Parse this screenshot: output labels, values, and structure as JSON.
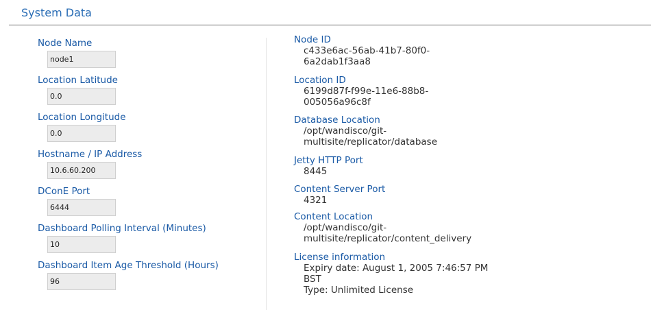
{
  "section": {
    "title": "System Data"
  },
  "left_fields": [
    {
      "label": "Node Name",
      "value": "node1"
    },
    {
      "label": "Location Latitude",
      "value": "0.0"
    },
    {
      "label": "Location Longitude",
      "value": "0.0"
    },
    {
      "label": "Hostname / IP Address",
      "value": "10.6.60.200"
    },
    {
      "label": "DConE Port",
      "value": "6444"
    },
    {
      "label": "Dashboard Polling Interval (Minutes)",
      "value": "10"
    },
    {
      "label": "Dashboard Item Age Threshold (Hours)",
      "value": "96"
    }
  ],
  "right_info": {
    "node_id": {
      "label": "Node ID",
      "lines": [
        "c433e6ac-56ab-41b7-80f0-",
        "6a2dab1f3aa8"
      ]
    },
    "location_id": {
      "label": "Location ID",
      "lines": [
        "6199d87f-f99e-11e6-88b8-",
        "005056a96c8f"
      ]
    },
    "database_location": {
      "label": "Database Location",
      "lines": [
        "/opt/wandisco/git-",
        "multisite/replicator/database"
      ]
    },
    "jetty_http_port": {
      "label": "Jetty HTTP Port",
      "lines": [
        "8445"
      ]
    },
    "content_server_port": {
      "label": "Content Server Port",
      "lines": [
        "4321"
      ]
    },
    "content_location": {
      "label": "Content Location",
      "lines": [
        "/opt/wandisco/git-",
        "multisite/replicator/content_delivery"
      ]
    },
    "license_information": {
      "label": "License information",
      "lines": [
        "Expiry date: August 1, 2005 7:46:57 PM",
        "BST",
        "Type: Unlimited License"
      ]
    }
  }
}
